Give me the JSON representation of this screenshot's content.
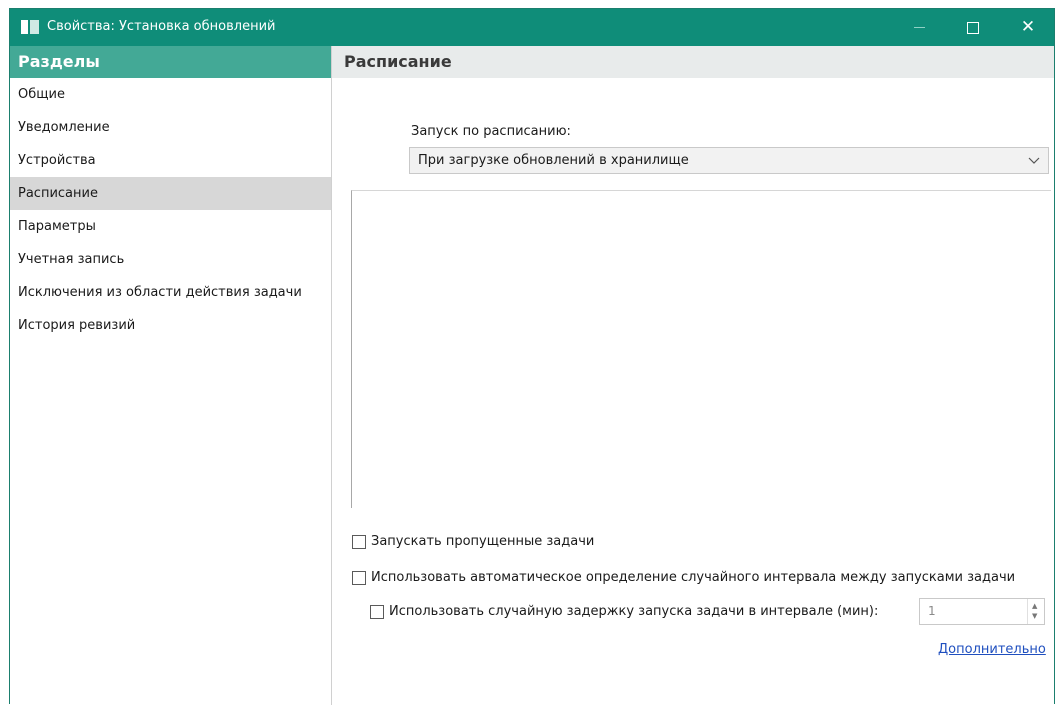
{
  "window": {
    "title": "Свойства: Установка обновлений"
  },
  "titlebar_buttons": {
    "minimize": "—",
    "maximize": "□",
    "close": "✕"
  },
  "sidebar": {
    "header": "Разделы",
    "items": [
      {
        "label": "Общие"
      },
      {
        "label": "Уведомление"
      },
      {
        "label": "Устройства"
      },
      {
        "label": "Расписание",
        "active": true
      },
      {
        "label": "Параметры"
      },
      {
        "label": "Учетная запись"
      },
      {
        "label": "Исключения из области действия задачи"
      },
      {
        "label": "История ревизий"
      }
    ]
  },
  "content": {
    "header": "Расписание",
    "schedule_label": "Запуск по расписанию:",
    "schedule_value": "При загрузке обновлений в хранилище",
    "checkboxes": {
      "missed_tasks": {
        "label": "Запускать пропущенные задачи",
        "checked": false
      },
      "auto_random_interval": {
        "label": "Использовать автоматическое определение случайного интервала между запусками задачи",
        "checked": false
      },
      "random_delay": {
        "label": "Использовать случайную задержку запуска задачи в интервале (мин):",
        "checked": false
      }
    },
    "delay_value": "1",
    "more_link": "Дополнительно"
  },
  "colors": {
    "titlebar": "#0f8d79",
    "sidebar_header": "#43a996",
    "active_item": "#d7d7d7",
    "link": "#1f4fbf"
  }
}
